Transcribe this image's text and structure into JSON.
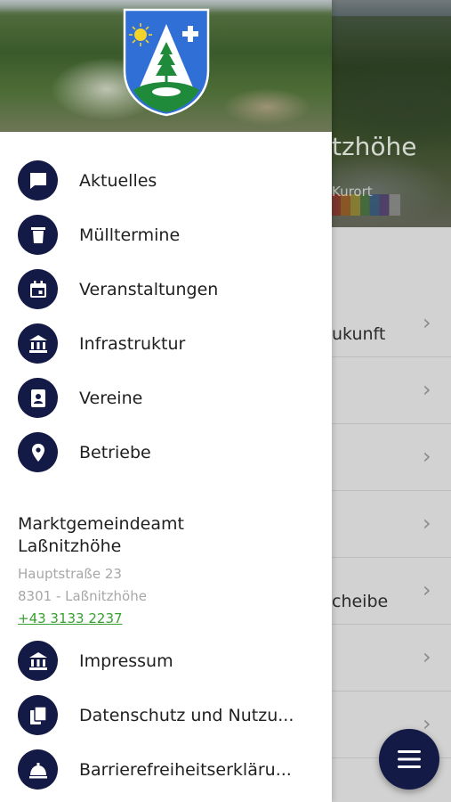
{
  "background": {
    "title_fragment": "tzhöhe",
    "subtitle_fragment": "Kurort",
    "rows": [
      {
        "text": "ukunft"
      },
      {
        "text": ""
      },
      {
        "text": ""
      },
      {
        "text": ""
      },
      {
        "text": "cheibe"
      },
      {
        "text": ""
      },
      {
        "text": ""
      }
    ]
  },
  "drawer": {
    "menu": [
      {
        "label": "Aktuelles",
        "icon": "chat-icon"
      },
      {
        "label": "Mülltermine",
        "icon": "trash-icon"
      },
      {
        "label": "Veranstaltungen",
        "icon": "calendar-icon"
      },
      {
        "label": "Infrastruktur",
        "icon": "building-icon"
      },
      {
        "label": "Vereine",
        "icon": "badge-icon"
      },
      {
        "label": "Betriebe",
        "icon": "location-pin-icon"
      }
    ],
    "contact": {
      "org_line1": "Marktgemeindeamt",
      "org_line2": "Laßnitzhöhe",
      "street": "Hauptstraße 23",
      "city": "8301 - Laßnitzhöhe",
      "phone": "+43 3133 2237"
    },
    "menu2": [
      {
        "label": "Impressum",
        "icon": "building-icon"
      },
      {
        "label": "Datenschutz und Nutzu...",
        "icon": "documents-icon"
      },
      {
        "label": "Barrierefreiheitserkläru...",
        "icon": "service-bell-icon"
      }
    ]
  },
  "colors": {
    "accent": "#141a46",
    "link": "#37a030",
    "coat_blue": "#2f6fd6",
    "coat_green": "#1f8a3a"
  }
}
